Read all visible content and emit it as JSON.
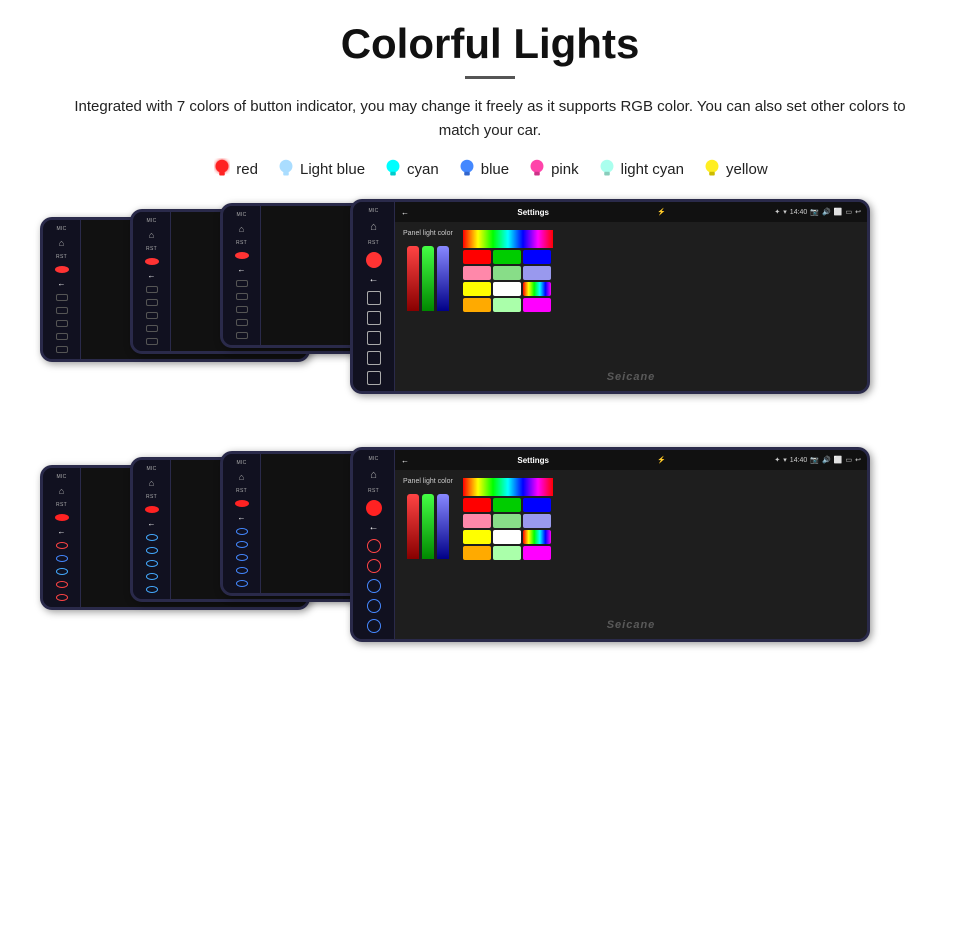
{
  "header": {
    "title": "Colorful Lights",
    "divider": true,
    "description": "Integrated with 7 colors of button indicator, you may change it freely as it supports RGB color. You can also set other colors to match your car."
  },
  "colors": [
    {
      "name": "red",
      "hex": "#ff2222",
      "glow": "#ff6666"
    },
    {
      "name": "Light blue",
      "hex": "#aaddff",
      "glow": "#aaddff"
    },
    {
      "name": "cyan",
      "hex": "#00ffff",
      "glow": "#00ffff"
    },
    {
      "name": "blue",
      "hex": "#4488ff",
      "glow": "#4488ff"
    },
    {
      "name": "pink",
      "hex": "#ff88cc",
      "glow": "#ff88cc"
    },
    {
      "name": "light cyan",
      "hex": "#aaffee",
      "glow": "#aaffee"
    },
    {
      "name": "yellow",
      "hex": "#ffee22",
      "glow": "#ffee44"
    }
  ],
  "devices": {
    "screen_title": "Settings",
    "panel_light_label": "Panel light color",
    "watermark": "Seicane",
    "time": "14:40",
    "grid_colors": [
      "#ff0000",
      "#00cc00",
      "#0000ff",
      "#ff88aa",
      "#88dd88",
      "#9999ee",
      "#ffff00",
      "#ffffff",
      "#ee4400",
      "#ffaa00",
      "#aaffaa",
      "#ff00ff"
    ]
  }
}
